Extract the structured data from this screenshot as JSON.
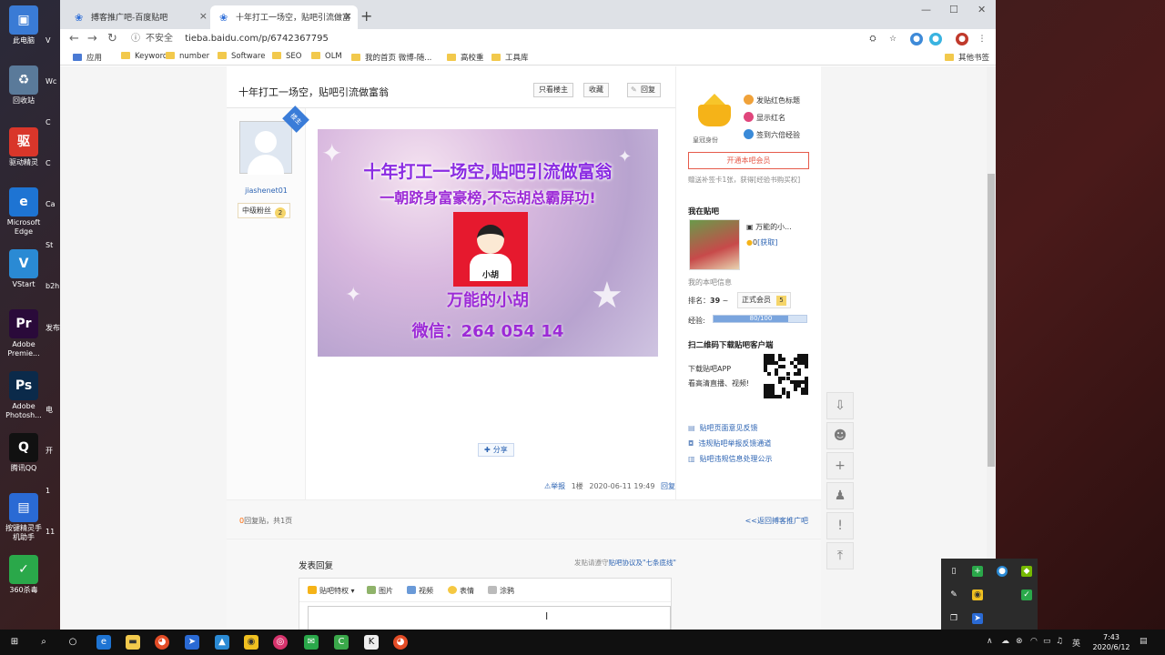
{
  "desktop": {
    "icons": [
      {
        "label": "此电脑",
        "color": "#3a7bd5",
        "glyph": "▣"
      },
      {
        "label": "回收站",
        "color": "#5a7a9a",
        "glyph": "♻"
      },
      {
        "label": "驱动精灵",
        "color": "#d9362a",
        "glyph": "驱"
      },
      {
        "label": "Microsoft Edge",
        "color": "#1e74d3",
        "glyph": "e"
      },
      {
        "label": "VStart",
        "color": "#2a8ad4",
        "glyph": "V"
      },
      {
        "label": "Adobe Premie...",
        "color": "#2a0a3a",
        "glyph": "Pr"
      },
      {
        "label": "Adobe Photosh...",
        "color": "#0b2a4a",
        "glyph": "Ps"
      },
      {
        "label": "腾讯QQ",
        "color": "#111",
        "glyph": "Q"
      },
      {
        "label": "按键精灵手机助手",
        "color": "#2a6ad4",
        "glyph": "▤"
      },
      {
        "label": "360杀毒",
        "color": "#2aa84a",
        "glyph": "✓"
      }
    ],
    "col2": [
      "V",
      "Wc",
      "C",
      "C",
      "Ca",
      "St",
      "b2h",
      "发布",
      "",
      "电",
      "开",
      "1",
      "11"
    ]
  },
  "browser": {
    "tabs": [
      {
        "title": "搏客推广吧-百度贴吧"
      },
      {
        "title": "十年打工一场空，贴吧引流做富"
      }
    ],
    "security": "不安全",
    "url": "tieba.baidu.com/p/6742367795",
    "bookmarks": [
      "应用",
      "Keyword",
      "number",
      "Software",
      "SEO",
      "OLM",
      "我的首页 微博-随...",
      "高校重",
      "工具库",
      "其他书签"
    ]
  },
  "post": {
    "title": "十年打工一场空，贴吧引流做富翁",
    "buttons": {
      "only_op": "只看楼主",
      "favorite": "收藏",
      "reply": "回复"
    },
    "author": {
      "badge": "楼主",
      "name": "jiashenet01",
      "level_title": "中级粉丝",
      "level": "2"
    },
    "image": {
      "line1": "十年打工一场空,贴吧引流做富翁",
      "line2": "一朝跻身富豪榜,不忘胡总霸屏功!",
      "portrait_name": "小胡",
      "line3": "万能的小胡",
      "line4": "微信：264 054 14"
    },
    "share": "分享",
    "meta": {
      "report": "举报",
      "floor": "1楼",
      "datetime": "2020-06-11 19:49",
      "reply": "回复"
    }
  },
  "sidebar": {
    "crown_label": "皇冠身份",
    "perks": [
      "发贴红色标题",
      "显示红名",
      "签到六倍经验"
    ],
    "member_button": "开通本吧会员",
    "member_sub": "赠送补签卡1张，获得[经验书购买权]",
    "my_bar_title": "我在贴吧",
    "bar_name": "万能的小...",
    "coins": "0",
    "get": "[获取]",
    "my_info": "我的本吧信息",
    "rank_label": "排名：",
    "rank": "39",
    "member_tag": "正式会员",
    "member_level": "5",
    "exp_label": "经验:",
    "exp_text": "80/100",
    "exp_ratio": 0.8,
    "qr_title": "扫二维码下载贴吧客户端",
    "download": "下载贴吧APP",
    "download_sub": "看高清直播、视频!",
    "feedback": [
      "贴吧页面意见反馈",
      "违规贴吧举报反馈通道",
      "贴吧违规信息处理公示"
    ]
  },
  "footer": {
    "reply_num": "0",
    "reply_text": "回复贴，共1页",
    "back": "<<返回搏客推广吧"
  },
  "reply": {
    "title": "发表回复",
    "notice_pre": "发贴请遵守",
    "notice_link": "贴吧协议及\"七条底线\"",
    "tools": [
      "贴吧特权",
      "图片",
      "视频",
      "表情",
      "涂鸦"
    ]
  },
  "taskbar": {
    "time": "7:43",
    "date": "2020/6/12",
    "ime": "英"
  }
}
